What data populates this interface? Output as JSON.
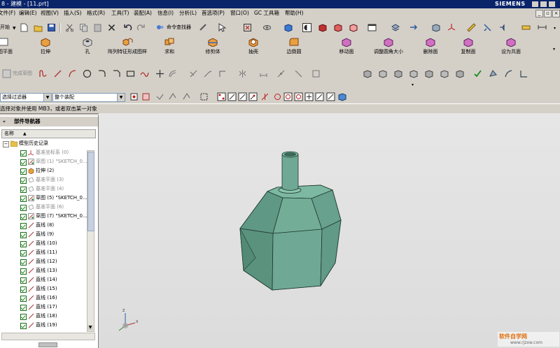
{
  "window": {
    "title": "8 - 建模 - [11.prt]",
    "brand": "SIEMENS"
  },
  "menu": [
    "文件(F)",
    "编辑(E)",
    "视图(V)",
    "插入(S)",
    "格式(R)",
    "工具(T)",
    "装配(A)",
    "信息(I)",
    "分析(L)",
    "首选项(P)",
    "窗口(O)",
    "GC 工具箱",
    "帮助(H)"
  ],
  "toolbar1": {
    "start_label": "开始",
    "command_finder": "命令查找器"
  },
  "ribbon": [
    "草图平面",
    "拉伸",
    "孔",
    "阵列特征形成图样",
    "求和",
    "修剪体",
    "抽壳",
    "边倒圆",
    "移动面",
    "调整圆角大小",
    "删除面",
    "复制面",
    "设为共面"
  ],
  "sketch_toolbar": {
    "finish_label": "完成草图"
  },
  "filters": {
    "type_filter": "选择过滤器",
    "assembly_scope": "整个装配"
  },
  "status": {
    "prompt": "选择对象并使用 MB3，或者双击某一对象"
  },
  "navigator": {
    "title": "部件导航器",
    "column_name": "名称",
    "root": "模型历史记录",
    "items": [
      {
        "label": "基准坐标系 (0)",
        "icon": "datum-csys-icon",
        "dim": true
      },
      {
        "label": "草图 (1) \"SKETCH_0...",
        "icon": "sketch-icon",
        "dim": true
      },
      {
        "label": "拉伸 (2)",
        "icon": "extrude-icon",
        "dim": false
      },
      {
        "label": "基准平面 (3)",
        "icon": "datum-plane-icon",
        "dim": true
      },
      {
        "label": "基准平面 (4)",
        "icon": "datum-plane-icon",
        "dim": true
      },
      {
        "label": "草图 (5) \"SKETCH_0...",
        "icon": "sketch-icon",
        "dim": false
      },
      {
        "label": "基准平面 (6)",
        "icon": "datum-plane-icon",
        "dim": true
      },
      {
        "label": "草图 (7) \"SKETCH_0...",
        "icon": "sketch-icon",
        "dim": false
      },
      {
        "label": "直线 (8)",
        "icon": "line-icon",
        "dim": false
      },
      {
        "label": "直线 (9)",
        "icon": "line-icon",
        "dim": false
      },
      {
        "label": "直线 (10)",
        "icon": "line-icon",
        "dim": false
      },
      {
        "label": "直线 (11)",
        "icon": "line-icon",
        "dim": false
      },
      {
        "label": "直线 (12)",
        "icon": "line-icon",
        "dim": false
      },
      {
        "label": "直线 (13)",
        "icon": "line-icon",
        "dim": false
      },
      {
        "label": "直线 (14)",
        "icon": "line-icon",
        "dim": false
      },
      {
        "label": "直线 (15)",
        "icon": "line-icon",
        "dim": false
      },
      {
        "label": "直线 (16)",
        "icon": "line-icon",
        "dim": false
      },
      {
        "label": "直线 (17)",
        "icon": "line-icon",
        "dim": false
      },
      {
        "label": "直线 (18)",
        "icon": "line-icon",
        "dim": false
      },
      {
        "label": "直线 (19)",
        "icon": "line-icon",
        "dim": false
      }
    ]
  },
  "watermark": {
    "brand": "软件自学网",
    "url": "www.rjzxw.com"
  },
  "colors": {
    "titlebar": "#0a246a",
    "model_body": "#6fa894",
    "model_edge": "#1e3a30",
    "viewport_bg": "#e2e2e2",
    "check_green": "#1a8a1a"
  }
}
